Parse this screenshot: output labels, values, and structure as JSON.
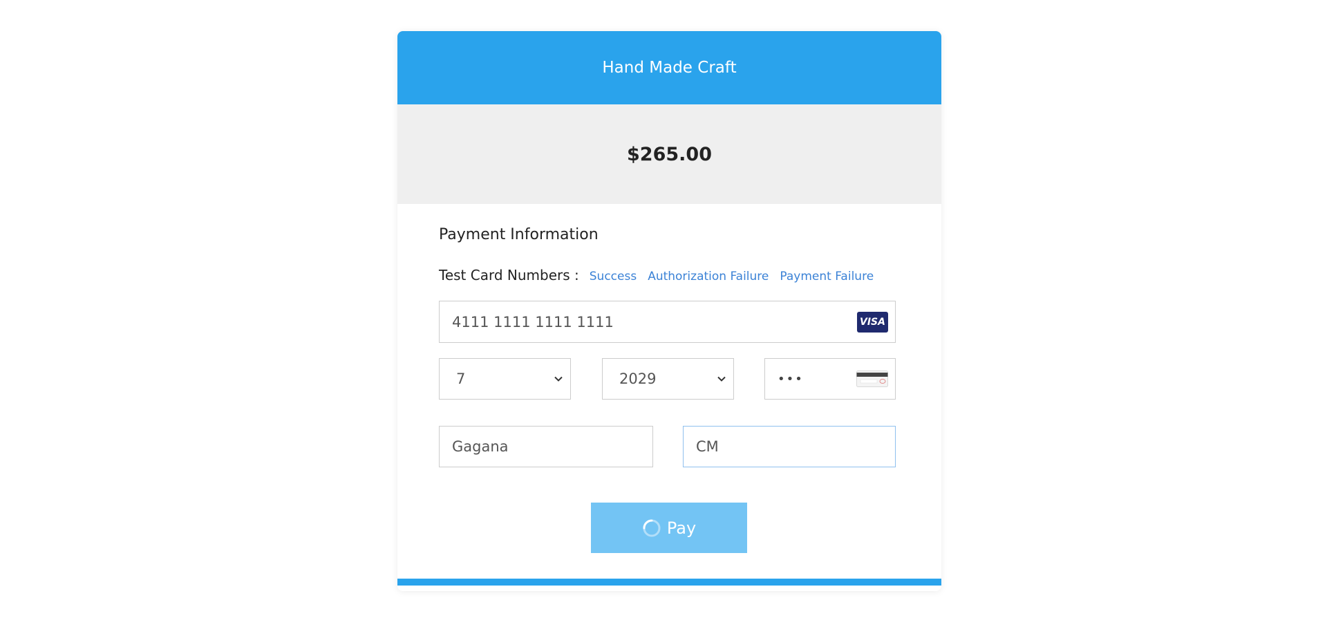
{
  "colors": {
    "brand": "#2aa3ec",
    "link": "#3b82d6",
    "pay_button": "#73c4f4",
    "visa_bg": "#1f2a6e",
    "focus_border": "#8fc0ee"
  },
  "header": {
    "title": "Hand Made Craft"
  },
  "amount": {
    "value": "$265.00"
  },
  "payment": {
    "section_title": "Payment Information",
    "test_cards": {
      "label": "Test Card Numbers :",
      "links": [
        "Success",
        "Authorization Failure",
        "Payment Failure"
      ]
    },
    "card_number": {
      "value": "4111 1111 1111 1111",
      "brand_icon": "visa-icon",
      "brand_text": "VISA"
    },
    "expiry_month": {
      "value": "7"
    },
    "expiry_year": {
      "value": "2029"
    },
    "cvv": {
      "value": "•••",
      "icon": "card-back-icon"
    },
    "first_name": {
      "value": "Gagana"
    },
    "last_name": {
      "value": "CM"
    },
    "pay_button": {
      "label": "Pay",
      "state": "loading"
    }
  }
}
